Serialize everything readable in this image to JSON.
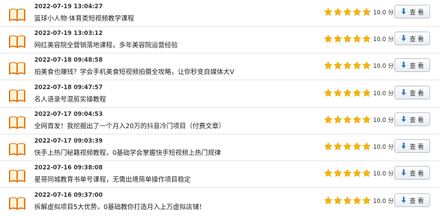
{
  "rating_stars": 5,
  "colors": {
    "star": "#f4b400",
    "book_cover": "#e07a1c",
    "book_page": "#fff3d6",
    "button_icon": "#2d7ac9"
  },
  "icons": {
    "row_icon": "open-book-icon",
    "rating_icon": "star-icon",
    "button_icon": "download-arrow-icon"
  },
  "items": [
    {
      "date": "2022-07-19 13:04:27",
      "title": "篮球小人物·体育类短视频教学课程",
      "score": "10.0 分",
      "button": "查 看"
    },
    {
      "date": "2022-07-19 13:03:12",
      "title": "网红美容院全营销落地课程，多年美容院运营经验",
      "score": "10.0 分",
      "button": "查 看"
    },
    {
      "date": "2022-07-18 09:48:58",
      "title": "拍美食也赚钱？学会手机美食短视频拍摄全攻略，让你秒变自媒体大V",
      "score": "10.0 分",
      "button": "查 看"
    },
    {
      "date": "2022-07-18 09:47:57",
      "title": "名人语录号混剪实操教程",
      "score": "10.0 分",
      "button": "查 看"
    },
    {
      "date": "2022-07-17 09:04:53",
      "title": "全网首发！我挖掘出了一个月入20万的抖音冷门项目（付费文章）",
      "score": "10.0 分",
      "button": "查 看"
    },
    {
      "date": "2022-07-17 09:03:39",
      "title": "快手上热门秘籍视频教程，0基础学会掌握快手短视频上热门规律",
      "score": "10.0 分",
      "button": "查 看"
    },
    {
      "date": "2022-07-16 09:38:08",
      "title": "星哥同城教育书单号课程，无需出境简单操作项目稳定",
      "score": "10.0 分",
      "button": "查 看"
    },
    {
      "date": "2022-07-16 09:37:00",
      "title": "拆解虚拟项目5大优势，0基础教你打造月入上万虚拟店铺！",
      "score": "10.0 分",
      "button": "查 看"
    }
  ]
}
